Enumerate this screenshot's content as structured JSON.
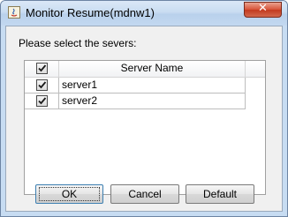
{
  "window": {
    "title": "Monitor Resume(mdnw1)",
    "close_symbol": "✕",
    "app_icon": "java-app-icon"
  },
  "dialog": {
    "prompt": "Please select the severs:"
  },
  "table": {
    "columns": [
      "",
      "Server Name"
    ],
    "header_checked": true,
    "rows": [
      {
        "checked": true,
        "name": "server1"
      },
      {
        "checked": true,
        "name": "server2"
      }
    ]
  },
  "buttons": {
    "ok": "OK",
    "cancel": "Cancel",
    "default": "Default"
  },
  "colors": {
    "titlebar": "#c9dcf1",
    "close_button": "#d8553b",
    "client_bg": "#f0f0f0",
    "focus_border": "#3c7fb1"
  }
}
